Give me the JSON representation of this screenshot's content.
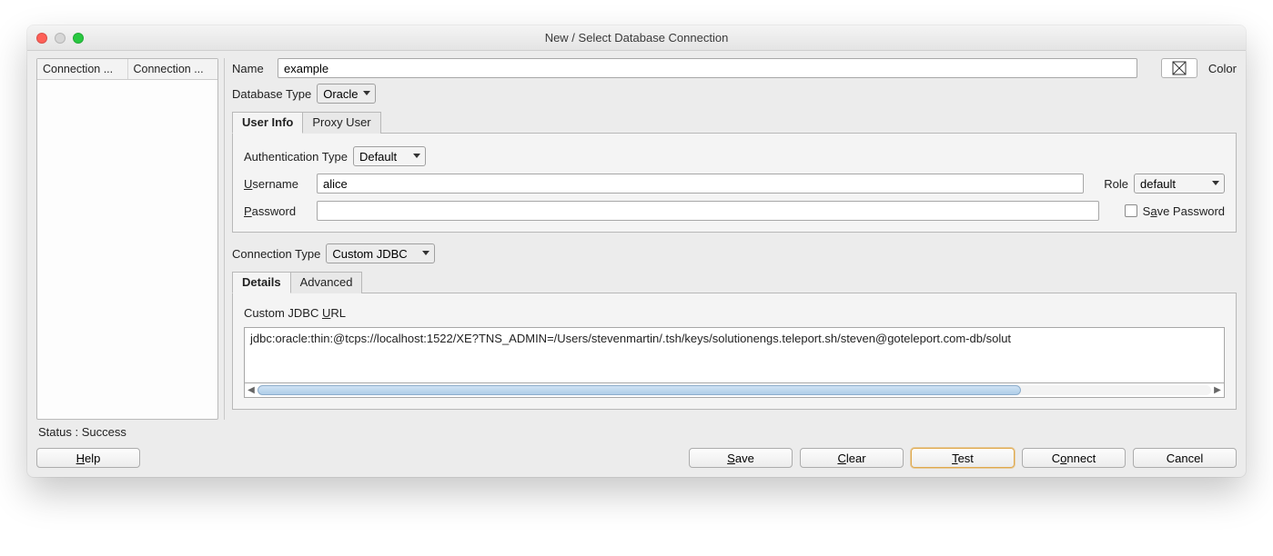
{
  "window": {
    "title": "New / Select Database Connection"
  },
  "sidebar": {
    "col1": "Connection ...",
    "col2": "Connection ..."
  },
  "name": {
    "label": "Name",
    "value": "example"
  },
  "color": {
    "label": "Color"
  },
  "dbtype": {
    "label": "Database Type",
    "value": "Oracle"
  },
  "tabs": {
    "user_info": "User Info",
    "proxy_user": "Proxy User"
  },
  "auth": {
    "label": "Authentication Type",
    "value": "Default"
  },
  "username": {
    "label": "Username",
    "value": "alice"
  },
  "role": {
    "label": "Role",
    "value": "default"
  },
  "password": {
    "label": "Password",
    "value": ""
  },
  "save_password": {
    "label": "Save Password"
  },
  "conn_type": {
    "label": "Connection Type",
    "value": "Custom JDBC"
  },
  "inner_tabs": {
    "details": "Details",
    "advanced": "Advanced"
  },
  "jdbc": {
    "label": "Custom JDBC URL",
    "value": "jdbc:oracle:thin:@tcps://localhost:1522/XE?TNS_ADMIN=/Users/stevenmartin/.tsh/keys/solutionengs.teleport.sh/steven@goteleport.com-db/solut"
  },
  "status": {
    "text": "Status : Success"
  },
  "buttons": {
    "help": "Help",
    "save": "Save",
    "clear": "Clear",
    "test": "Test",
    "connect": "Connect",
    "cancel": "Cancel"
  }
}
